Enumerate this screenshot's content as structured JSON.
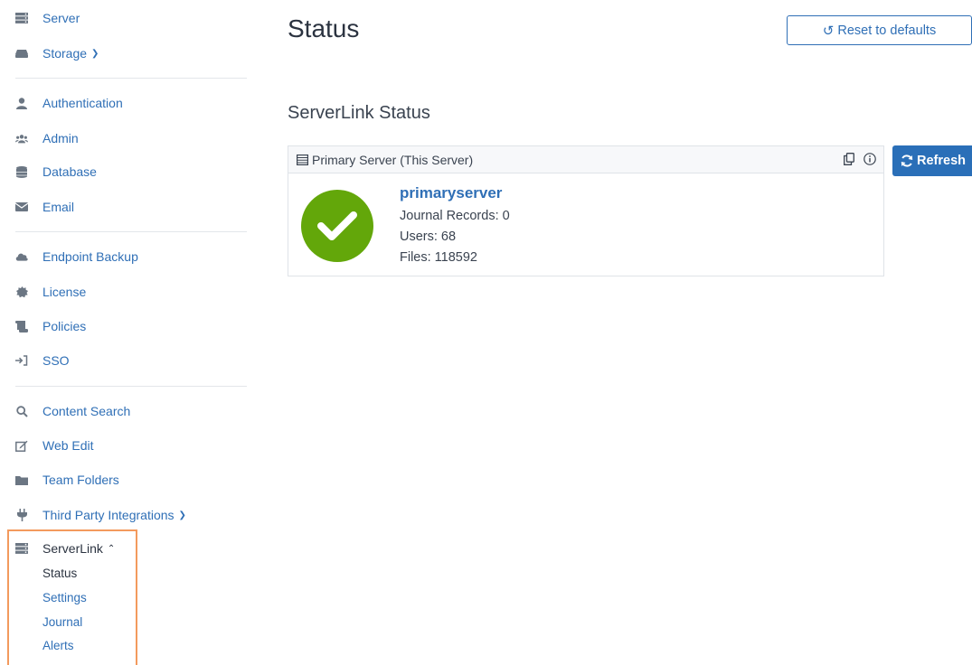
{
  "sidebar": {
    "items": [
      {
        "label": "Server",
        "icon": "server-icon"
      },
      {
        "label": "Storage",
        "icon": "hard-drive-icon"
      },
      {
        "label": "Authentication",
        "icon": "user-icon"
      },
      {
        "label": "Admin",
        "icon": "users-icon"
      },
      {
        "label": "Database",
        "icon": "database-icon"
      },
      {
        "label": "Email",
        "icon": "envelope-icon"
      },
      {
        "label": "Endpoint Backup",
        "icon": "cloud-icon"
      },
      {
        "label": "License",
        "icon": "badge-icon"
      },
      {
        "label": "Policies",
        "icon": "scroll-icon"
      },
      {
        "label": "SSO",
        "icon": "sign-in-icon"
      },
      {
        "label": "Content Search",
        "icon": "search-icon"
      },
      {
        "label": "Web Edit",
        "icon": "edit-icon"
      },
      {
        "label": "Team Folders",
        "icon": "folder-icon"
      },
      {
        "label": "Third Party Integrations",
        "icon": "plug-icon"
      },
      {
        "label": "ServerLink",
        "icon": "server-icon"
      }
    ],
    "serverlink_sub": [
      "Status",
      "Settings",
      "Journal",
      "Alerts"
    ],
    "highlight_color": "#f39a5d"
  },
  "main": {
    "title": "Status",
    "reset_label": "Reset to defaults",
    "section_title": "ServerLink Status",
    "refresh_label": "Refresh",
    "card": {
      "header": "Primary Server (This Server)",
      "server_name": "primaryserver",
      "journal_records": "Journal Records: 0",
      "users": "Users: 68",
      "files": "Files: 118592",
      "status_color": "#63a70a"
    }
  },
  "colors": {
    "accent": "#2f6fb6",
    "button": "#2a6fb8"
  }
}
